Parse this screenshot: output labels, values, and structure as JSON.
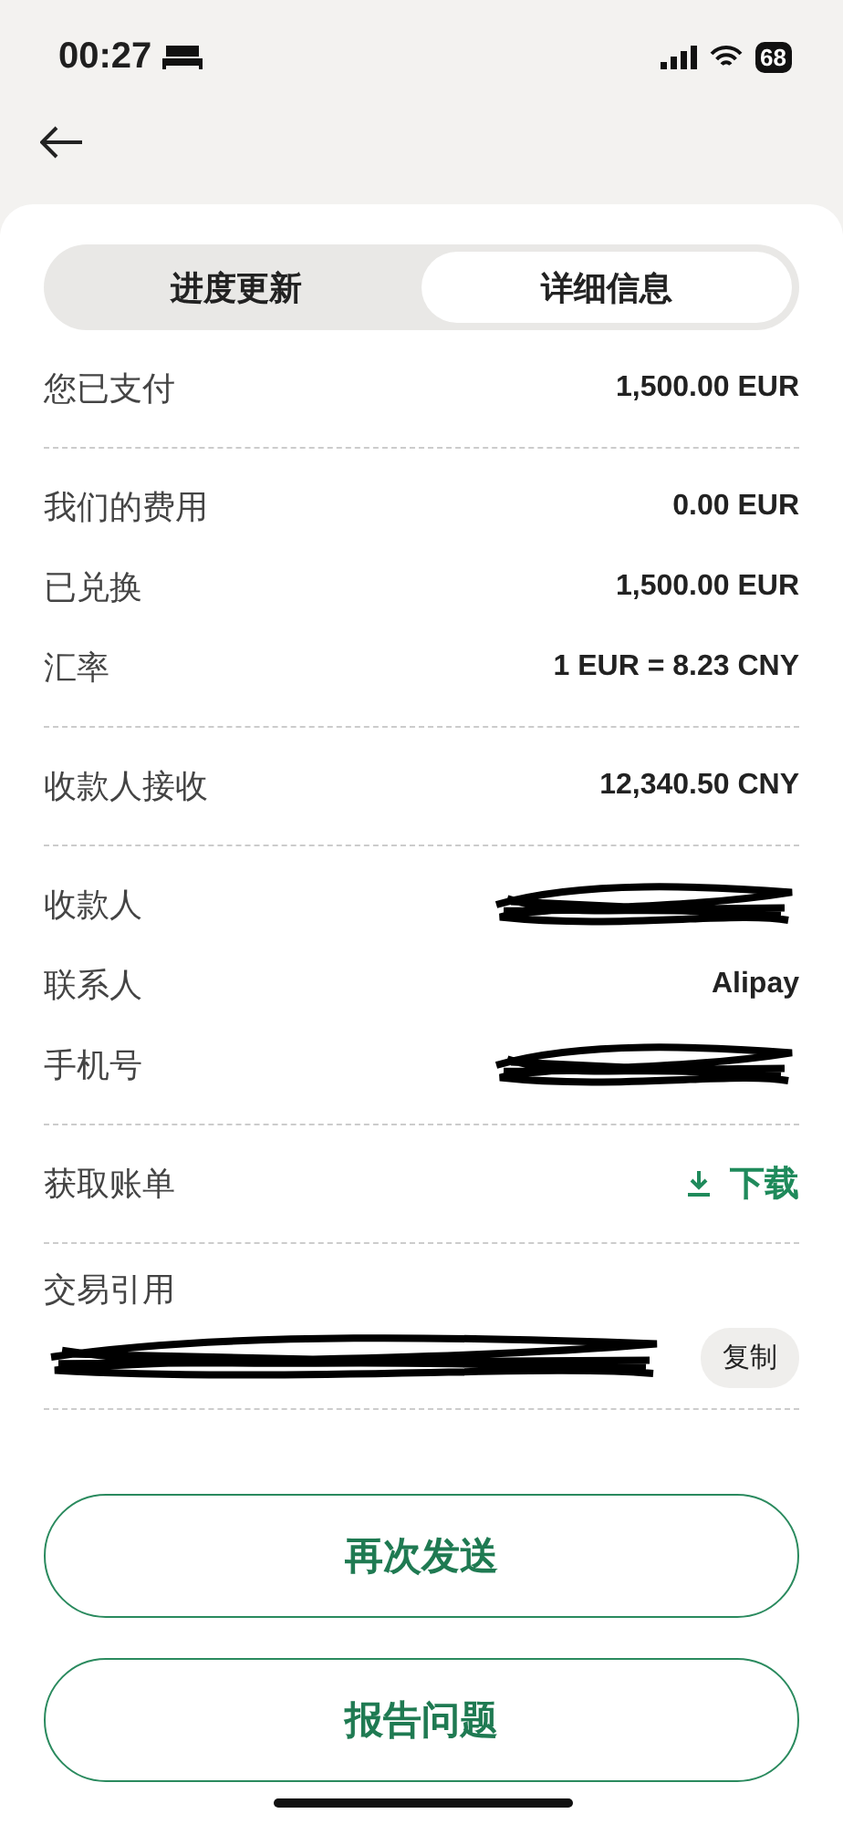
{
  "status_bar": {
    "time": "00:27",
    "battery": "68"
  },
  "tabs": [
    {
      "label": "进度更新",
      "selected": false
    },
    {
      "label": "详细信息",
      "selected": true
    }
  ],
  "sections": [
    {
      "rows": [
        {
          "kind": "value",
          "label": "您已支付",
          "value": "1,500.00 EUR"
        }
      ]
    },
    {
      "rows": [
        {
          "kind": "value",
          "label": "我们的费用",
          "value": "0.00 EUR"
        },
        {
          "kind": "value",
          "label": "已兑换",
          "value": "1,500.00 EUR"
        },
        {
          "kind": "value",
          "label": "汇率",
          "value": "1 EUR = 8.23 CNY"
        }
      ]
    },
    {
      "rows": [
        {
          "kind": "value",
          "label": "收款人接收",
          "value": "12,340.50 CNY"
        }
      ]
    },
    {
      "rows": [
        {
          "kind": "redacted",
          "label": "收款人"
        },
        {
          "kind": "value",
          "label": "联系人",
          "value": "Alipay"
        },
        {
          "kind": "redacted",
          "label": "手机号"
        }
      ]
    },
    {
      "rows": [
        {
          "kind": "link",
          "label": "获取账单",
          "value": "下载"
        }
      ]
    },
    {
      "rows": [
        {
          "kind": "reference",
          "label": "交易引用",
          "action": "复制"
        }
      ]
    }
  ],
  "buttons": [
    "再次发送",
    "报告问题"
  ]
}
